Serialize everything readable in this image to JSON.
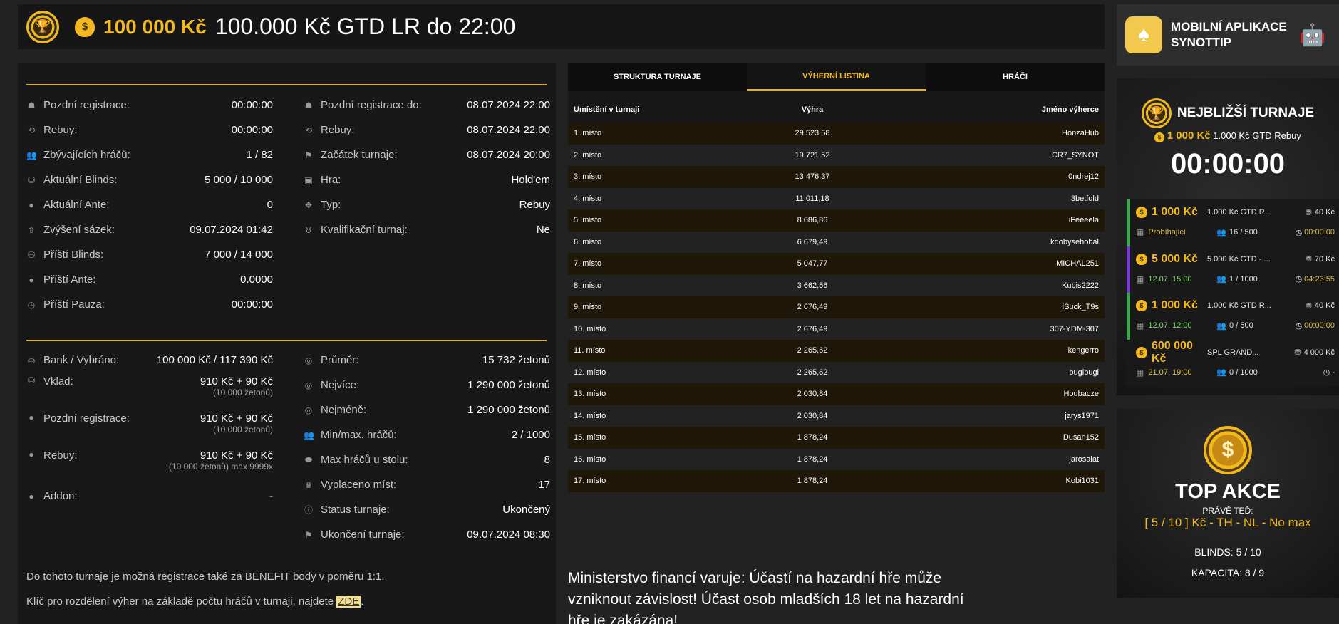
{
  "header": {
    "amount": "100 000 Kč",
    "title": "100.000 Kč GTD LR do 22:00",
    "logo_icon": "trophy-chip-icon",
    "bag_icon": "money-bag-icon"
  },
  "info_left": [
    {
      "icon": "late-reg-icon",
      "glyph": "☗",
      "label": "Pozdní registrace:",
      "value": "00:00:00"
    },
    {
      "icon": "rebuy-icon",
      "glyph": "⟲",
      "label": "Rebuy:",
      "value": "00:00:00"
    },
    {
      "icon": "players-icon",
      "glyph": "👥",
      "label": "Zbývajících hráčů:",
      "value": "1 / 82"
    },
    {
      "icon": "blinds-icon",
      "glyph": "⛁",
      "label": "Aktuální Blinds:",
      "value": "5 000 / 10 000"
    },
    {
      "icon": "ante-icon",
      "glyph": "●",
      "label": "Aktuální Ante:",
      "value": "0"
    },
    {
      "icon": "raise-icon",
      "glyph": "⇧",
      "label": "Zvýšení sázek:",
      "value": "09.07.2024 01:42"
    },
    {
      "icon": "next-blinds-icon",
      "glyph": "⛁",
      "label": "Příští Blinds:",
      "value": "7 000 / 14 000"
    },
    {
      "icon": "next-ante-icon",
      "glyph": "●",
      "label": "Příští Ante:",
      "value": "0.0000"
    },
    {
      "icon": "clock-icon",
      "glyph": "◷",
      "label": "Příští Pauza:",
      "value": "00:00:00"
    }
  ],
  "info_right": [
    {
      "icon": "late-reg-icon",
      "glyph": "☗",
      "label": "Pozdní registrace do:",
      "value": "08.07.2024 22:00"
    },
    {
      "icon": "rebuy-icon",
      "glyph": "⟲",
      "label": "Rebuy:",
      "value": "08.07.2024 22:00"
    },
    {
      "icon": "start-flag-icon",
      "glyph": "⚑",
      "label": "Začátek turnaje:",
      "value": "08.07.2024 20:00"
    },
    {
      "icon": "game-icon",
      "glyph": "▣",
      "label": "Hra:",
      "value": "Hold'em"
    },
    {
      "icon": "type-icon",
      "glyph": "✥",
      "label": "Typ:",
      "value": "Rebuy"
    },
    {
      "icon": "medal-icon",
      "glyph": "♉",
      "label": "Kvalifikační turnaj:",
      "value": "Ne"
    }
  ],
  "bank": {
    "icon": "bank-icon",
    "glyph": "⛀",
    "label": "Bank / Vybráno:",
    "value": "100 000 Kč / 117 390 Kč"
  },
  "fees_left": [
    {
      "icon": "deposit-icon",
      "glyph": "⛁",
      "label": "Vklad:",
      "value": "910 Kč + 90 Kč",
      "sub": "(10 000 žetonů)"
    },
    {
      "icon": "late-reg-fee-icon",
      "glyph": "●",
      "label": "Pozdní registrace:",
      "value": "910 Kč + 90 Kč",
      "sub": "(10 000 žetonů)"
    },
    {
      "icon": "rebuy-fee-icon",
      "glyph": "●",
      "label": "Rebuy:",
      "value": "910 Kč + 90 Kč",
      "sub": "(10 000 žetonů) max 9999x"
    },
    {
      "icon": "addon-icon",
      "glyph": "●",
      "label": "Addon:",
      "value": "-",
      "sub": ""
    }
  ],
  "stats_right": [
    {
      "icon": "average-icon",
      "glyph": "◎",
      "label": "Průměr:",
      "value": "15 732 žetonů"
    },
    {
      "icon": "most-icon",
      "glyph": "◎",
      "label": "Nejvíce:",
      "value": "1 290 000 žetonů"
    },
    {
      "icon": "least-icon",
      "glyph": "◎",
      "label": "Nejméně:",
      "value": "1 290 000 žetonů"
    },
    {
      "icon": "players-icon",
      "glyph": "👥",
      "label": "Min/max. hráčů:",
      "value": "2 / 1000"
    },
    {
      "icon": "table-icon",
      "glyph": "⬬",
      "label": "Max hráčů u stolu:",
      "value": "8"
    },
    {
      "icon": "paid-places-icon",
      "glyph": "♛",
      "label": "Vyplaceno míst:",
      "value": "17"
    },
    {
      "icon": "status-icon",
      "glyph": "ⓘ",
      "label": "Status turnaje:",
      "value": "Ukončený"
    },
    {
      "icon": "end-flag-icon",
      "glyph": "⚑",
      "label": "Ukončení turnaje:",
      "value": "09.07.2024 08:30"
    }
  ],
  "notes": {
    "benefit": "Do tohoto turnaje je možná registrace také za BENEFIT body v poměru 1:1.",
    "key_text": "Klíč pro rozdělení výher na základě počtu hráčů v turnaji, najdete",
    "key_link": "ZDE",
    "key_end": "."
  },
  "tabs": [
    "STRUKTURA TURNAJE",
    "VÝHERNÍ LISTINA",
    "HRÁČI"
  ],
  "winners": {
    "headers": [
      "Umístění v turnaji",
      "Výhra",
      "Jméno výherce"
    ],
    "rows": [
      [
        "1. místo",
        "29 523,58",
        "HonzaHub"
      ],
      [
        "2. místo",
        "19 721,52",
        "CR7_SYNOT"
      ],
      [
        "3. místo",
        "13 476,37",
        "0ndrej12"
      ],
      [
        "4. místo",
        "11 011,18",
        "3betfold"
      ],
      [
        "5. místo",
        "8 686,86",
        "iFeeeela"
      ],
      [
        "6. místo",
        "6 679,49",
        "kdobysehobal"
      ],
      [
        "7. místo",
        "5 047,77",
        "MICHAL251"
      ],
      [
        "8. místo",
        "3 662,56",
        "Kubis2222"
      ],
      [
        "9. místo",
        "2 676,49",
        "iSuck_T9s"
      ],
      [
        "10. místo",
        "2 676,49",
        "307-YDM-307"
      ],
      [
        "11. místo",
        "2 265,62",
        "kengerro"
      ],
      [
        "12. místo",
        "2 265,62",
        "bugibugi"
      ],
      [
        "13. místo",
        "2 030,84",
        "Houbacze"
      ],
      [
        "14. místo",
        "2 030,84",
        "jarys1971"
      ],
      [
        "15. místo",
        "1 878,24",
        "Dusan152"
      ],
      [
        "16. místo",
        "1 878,24",
        "jarosalat"
      ],
      [
        "17. místo",
        "1 878,24",
        "Kobi1031"
      ]
    ]
  },
  "warning": "Ministerstvo financí varuje: Účastí na hazardní hře může vzniknout závislost! Účast osob mladších 18 let na hazardní hře je zakázána!",
  "app_banner": {
    "title": "MOBILNÍ APLIKACE SYNOTTIP",
    "icon": "spade-app-icon",
    "platform_icon": "android-icon"
  },
  "nearest": {
    "title": "NEJBLIŽŠÍ TURNAJE",
    "amount": "1 000 Kč",
    "name": "1.000 Kč GTD Rebuy",
    "timer": "00:00:00",
    "tournaments": [
      {
        "amount": "1 000 Kč",
        "name": "1.000 Kč GTD R...",
        "buyin": "40 Kč",
        "status": "Probíhající",
        "players": "16 / 500",
        "time": "00:00:00",
        "accent": "#3aa64a"
      },
      {
        "amount": "5 000 Kč",
        "name": "5.000 Kč GTD - ...",
        "buyin": "70 Kč",
        "status": "12.07. 15:00",
        "players": "1 / 1000",
        "time": "04:23:55",
        "accent": "#7a3ad6"
      },
      {
        "amount": "1 000 Kč",
        "name": "1.000 Kč GTD R...",
        "buyin": "40 Kč",
        "status": "12.07. 12:00",
        "players": "0 / 500",
        "time": "00:00:00",
        "accent": "#3aa64a"
      },
      {
        "amount": "600 000 Kč",
        "name": "SPL GRAND...",
        "buyin": "4 000 Kč",
        "status": "21.07. 19:00",
        "players": "0 / 1000",
        "time": "-",
        "accent": ""
      }
    ]
  },
  "top": {
    "title": "TOP AKCE",
    "now_label": "PRÁVĚ TEĎ:",
    "game": "[ 5 / 10 ] Kč - TH - NL - No max",
    "blinds": "BLINDS: 5 / 10",
    "capacity": "KAPACITA: 8 / 9",
    "icon": "dollar-chip-icon"
  },
  "colors": {
    "accent": "#f2b81f",
    "background": "#222222",
    "panel": "#181818",
    "running": "#d6c04a",
    "scheduled": "#7ddc6e"
  }
}
